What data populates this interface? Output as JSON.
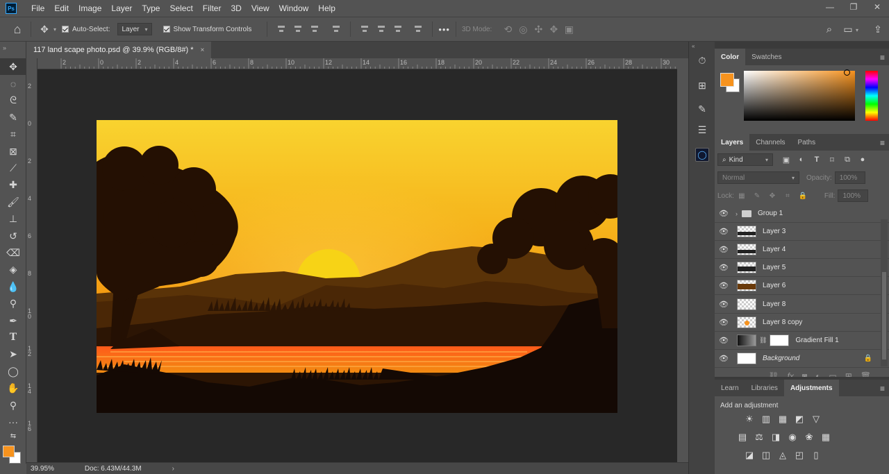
{
  "app": {
    "logo": "Ps"
  },
  "menu": [
    "File",
    "Edit",
    "Image",
    "Layer",
    "Type",
    "Select",
    "Filter",
    "3D",
    "View",
    "Window",
    "Help"
  ],
  "window_controls": {
    "minimize": "—",
    "restore": "❐",
    "close": "✕"
  },
  "options_bar": {
    "auto_select_label": "Auto-Select:",
    "auto_select_value": "Layer",
    "show_transform_label": "Show Transform Controls",
    "more": "•••",
    "three_d_mode": "3D Mode:"
  },
  "document_tab": {
    "title": "117 land scape photo.psd @ 39.9% (RGB/8#) *",
    "close": "×"
  },
  "ruler": {
    "top": [
      "2",
      "0",
      "2",
      "4",
      "6",
      "8",
      "10",
      "12",
      "14",
      "16",
      "18",
      "20",
      "22",
      "24",
      "26",
      "28",
      "30"
    ],
    "left": [
      "2",
      "0",
      "2",
      "4",
      "6",
      "8",
      "1\n0",
      "1\n2",
      "1\n4",
      "1\n6"
    ]
  },
  "status_bar": {
    "zoom": "39.95%",
    "doc": "Doc: 6.43M/44.3M",
    "arrow": "›"
  },
  "panels": {
    "color_tabs": [
      "Color",
      "Swatches"
    ],
    "layers_tabs": [
      "Layers",
      "Channels",
      "Paths"
    ],
    "kind_label": "Kind",
    "blend_mode": "Normal",
    "opacity_label": "Opacity:",
    "opacity_value": "100%",
    "lock_label": "Lock:",
    "fill_label": "Fill:",
    "fill_value": "100%",
    "layers": [
      {
        "name": "Group 1",
        "type": "group"
      },
      {
        "name": "Layer 3",
        "type": "layer"
      },
      {
        "name": "Layer 4",
        "type": "layer"
      },
      {
        "name": "Layer 5",
        "type": "layer"
      },
      {
        "name": "Layer 6",
        "type": "layer"
      },
      {
        "name": "Layer 8",
        "type": "layer"
      },
      {
        "name": "Layer 8 copy",
        "type": "sun"
      },
      {
        "name": "Gradient Fill 1",
        "type": "gradient"
      },
      {
        "name": "Background",
        "type": "background"
      }
    ],
    "adjust_tabs": [
      "Learn",
      "Libraries",
      "Adjustments"
    ],
    "add_adjustment": "Add an adjustment"
  },
  "colors": {
    "foreground": "#f7931e",
    "background": "#ffffff",
    "ui_bg": "#535353"
  }
}
